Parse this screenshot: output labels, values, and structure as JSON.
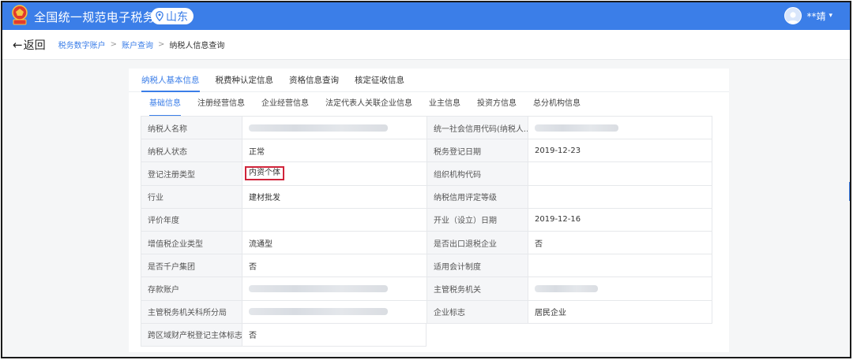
{
  "header": {
    "brand": "全国统一规范电子税务局",
    "region": "山东",
    "user": "**靖",
    "accent": "#3b7ee8"
  },
  "crumbbar": {
    "back_label": "返回",
    "crumbs": [
      "税务数字账户",
      "账户查询",
      "纳税人信息查询"
    ],
    "separator": ">"
  },
  "tabs_primary": [
    "纳税人基本信息",
    "税费种认定信息",
    "资格信息查询",
    "核定征收信息"
  ],
  "tabs_secondary": [
    "基础信息",
    "注册经营信息",
    "企业经营信息",
    "法定代表人关联企业信息",
    "业主信息",
    "投资方信息",
    "总分机构信息"
  ],
  "info_rows": [
    {
      "l1": "纳税人名称",
      "v1": "",
      "l2": "统一社会信用代码(纳税人...",
      "v2": ""
    },
    {
      "l1": "纳税人状态",
      "v1": "正常",
      "l2": "税务登记日期",
      "v2": "2019-12-23"
    },
    {
      "l1": "登记注册类型",
      "v1": "内资个体",
      "l2": "组织机构代码",
      "v2": ""
    },
    {
      "l1": "行业",
      "v1": "建材批发",
      "l2": "纳税信用评定等级",
      "v2": ""
    },
    {
      "l1": "评价年度",
      "v1": "",
      "l2": "开业（设立）日期",
      "v2": "2019-12-16"
    },
    {
      "l1": "增值税企业类型",
      "v1": "流通型",
      "l2": "是否出口退税企业",
      "v2": "否"
    },
    {
      "l1": "是否千户集团",
      "v1": "否",
      "l2": "适用会计制度",
      "v2": ""
    },
    {
      "l1": "存款账户",
      "v1": "",
      "l2": "主管税务机关",
      "v2": ""
    },
    {
      "l1": "主管税务机关科所分局",
      "v1": "",
      "l2": "企业标志",
      "v2": "居民企业"
    },
    {
      "l1": "跨区域财产税登记主体标志",
      "v1": "否"
    }
  ]
}
